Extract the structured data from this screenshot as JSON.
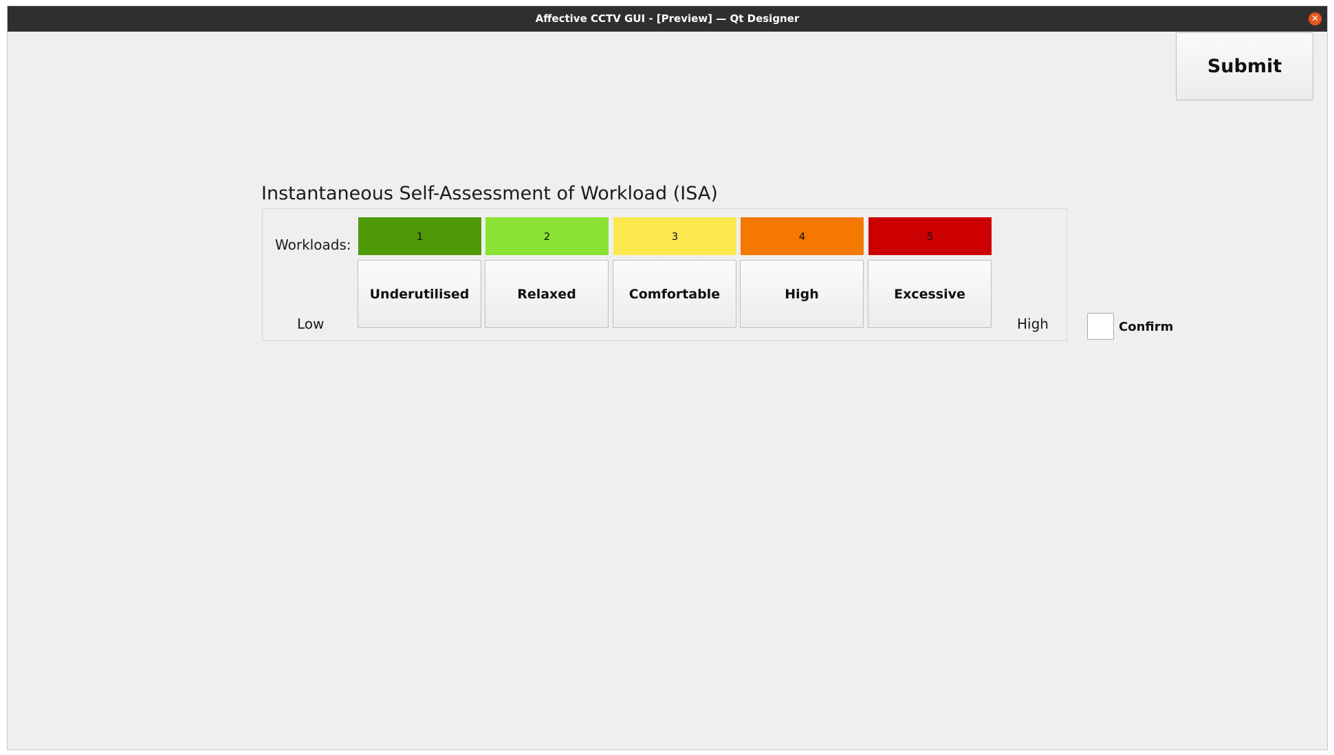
{
  "window": {
    "title": "Affective CCTV GUI - [Preview] — Qt Designer",
    "close_symbol": "✕",
    "close_icon": "close-icon"
  },
  "toolbar": {
    "submit_label": "Submit"
  },
  "isa": {
    "title": "Instantaneous Self-Assessment of Workload (ISA)",
    "workloads_label": "Workloads:",
    "low_label": "Low",
    "high_label": "High",
    "levels": [
      {
        "number": "1",
        "label": "Underutilised",
        "color": "#4e9a06"
      },
      {
        "number": "2",
        "label": "Relaxed",
        "color": "#8ae234"
      },
      {
        "number": "3",
        "label": "Comfortable",
        "color": "#fce94f"
      },
      {
        "number": "4",
        "label": "High",
        "color": "#f57900"
      },
      {
        "number": "5",
        "label": "Excessive",
        "color": "#cc0000"
      }
    ]
  },
  "confirm": {
    "label": "Confirm",
    "checked": false
  }
}
